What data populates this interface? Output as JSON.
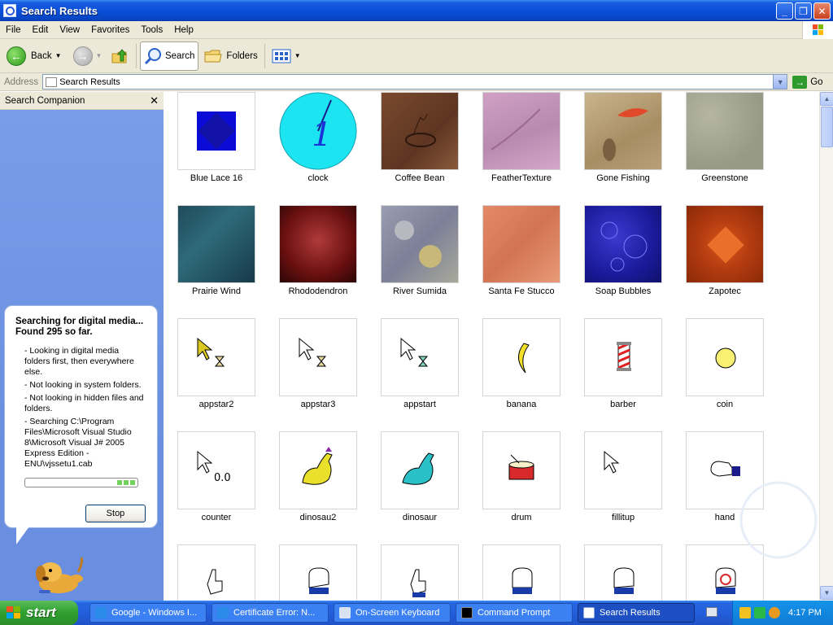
{
  "window": {
    "title": "Search Results"
  },
  "menu": [
    "File",
    "Edit",
    "View",
    "Favorites",
    "Tools",
    "Help"
  ],
  "toolbar": {
    "back": "Back",
    "search": "Search",
    "folders": "Folders"
  },
  "address": {
    "label": "Address",
    "value": "Search Results",
    "go": "Go"
  },
  "companion": {
    "title": "Search Companion",
    "headline": "Searching for digital media... Found 295 so far.",
    "lines": [
      "- Looking in digital media folders first, then everywhere else.",
      "- Not looking in system folders.",
      "- Not looking in hidden files and folders.",
      "- Searching C:\\Program Files\\Microsoft Visual Studio 8\\Microsoft Visual J# 2005 Express Edition - ENU\\vjssetu1.cab"
    ],
    "stop": "Stop"
  },
  "results": [
    {
      "name": "Blue Lace 16"
    },
    {
      "name": "clock"
    },
    {
      "name": "Coffee Bean"
    },
    {
      "name": "FeatherTexture"
    },
    {
      "name": "Gone Fishing"
    },
    {
      "name": "Greenstone"
    },
    {
      "name": "Prairie Wind"
    },
    {
      "name": "Rhododendron"
    },
    {
      "name": "River Sumida"
    },
    {
      "name": "Santa Fe Stucco"
    },
    {
      "name": "Soap Bubbles"
    },
    {
      "name": "Zapotec"
    },
    {
      "name": "appstar2"
    },
    {
      "name": "appstar3"
    },
    {
      "name": "appstart"
    },
    {
      "name": "banana"
    },
    {
      "name": "barber"
    },
    {
      "name": "coin"
    },
    {
      "name": "counter"
    },
    {
      "name": "dinosau2"
    },
    {
      "name": "dinosaur"
    },
    {
      "name": "drum"
    },
    {
      "name": "fillitup"
    },
    {
      "name": "hand"
    },
    {
      "name": ""
    },
    {
      "name": ""
    },
    {
      "name": ""
    },
    {
      "name": ""
    },
    {
      "name": ""
    },
    {
      "name": ""
    }
  ],
  "taskbar": {
    "start": "start",
    "tasks": [
      "Google - Windows I...",
      "Certificate Error: N...",
      "On-Screen Keyboard",
      "Command Prompt",
      "Search Results"
    ],
    "clock": "4:17 PM"
  },
  "colors": {
    "titlebar": "#0a4fd8",
    "companion": "#6a8fe0",
    "taskbar": "#245edc",
    "start": "#2e9f2e"
  }
}
